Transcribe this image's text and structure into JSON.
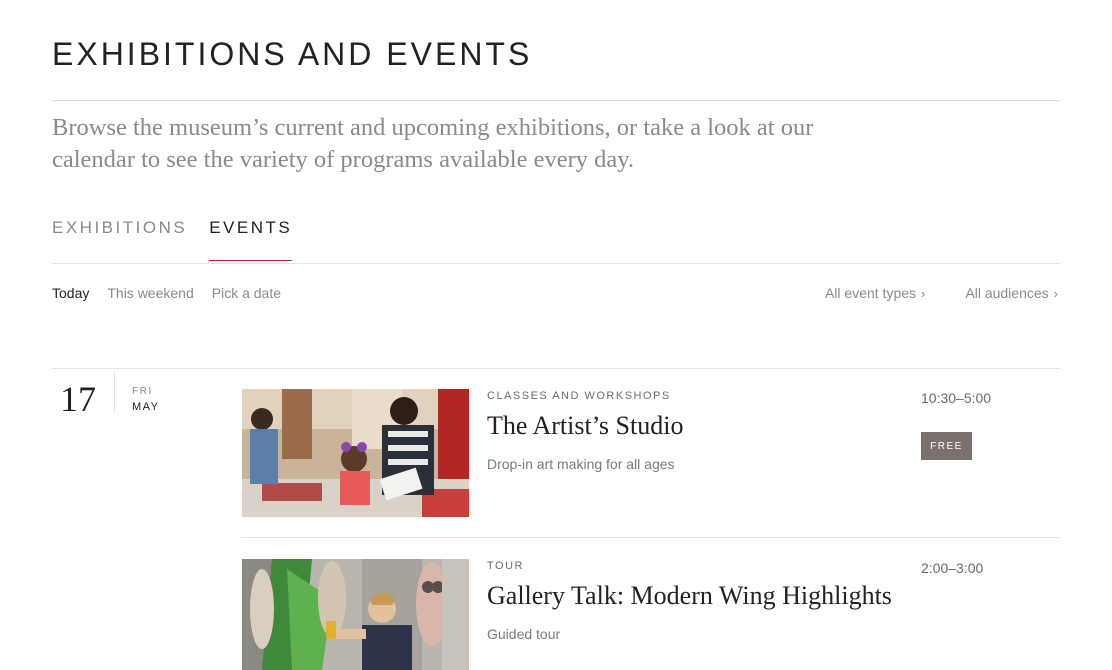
{
  "page": {
    "title": "EXHIBITIONS AND EVENTS",
    "intro": "Browse the museum’s current and upcoming exhibitions, or take a look at our calendar to see the variety of programs available every day."
  },
  "tabs": [
    {
      "label": "EXHIBITIONS",
      "active": false
    },
    {
      "label": "EVENTS",
      "active": true
    }
  ],
  "filters": {
    "date_filters": [
      {
        "label": "Today",
        "active": true
      },
      {
        "label": "This weekend",
        "active": false
      },
      {
        "label": "Pick a date",
        "active": false
      }
    ],
    "event_types": {
      "label": "All event types"
    },
    "audiences": {
      "label": "All audiences"
    }
  },
  "date": {
    "day": "17",
    "weekday": "FRI",
    "month": "MAY"
  },
  "events": [
    {
      "category": "CLASSES AND WORKSHOPS",
      "title": "The Artist’s Studio",
      "description": "Drop-in art making for all ages",
      "time": "10:30–5:00",
      "badge": "FREE",
      "image_icon": "workshop-photo"
    },
    {
      "category": "TOUR",
      "title": "Gallery Talk: Modern Wing Highlights",
      "description": "Guided tour",
      "time": "2:00–3:00",
      "image_icon": "gallery-photo"
    }
  ],
  "colors": {
    "accent": "#a8323a",
    "badge_bg": "#7b716c",
    "muted_text": "#8a8a8a"
  }
}
